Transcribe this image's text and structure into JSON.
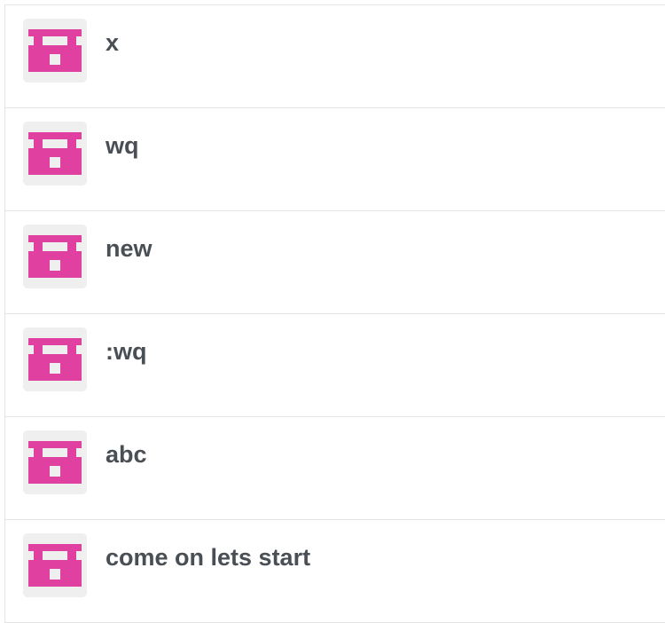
{
  "colors": {
    "avatar_pattern": "#e0409f",
    "avatar_background": "#efefef",
    "title_text": "#494f55",
    "divider": "#e4e4e4"
  },
  "items": [
    {
      "title": "x",
      "avatar_icon": "identicon"
    },
    {
      "title": "wq",
      "avatar_icon": "identicon"
    },
    {
      "title": "new",
      "avatar_icon": "identicon"
    },
    {
      "title": ":wq",
      "avatar_icon": "identicon"
    },
    {
      "title": "abc",
      "avatar_icon": "identicon"
    },
    {
      "title": "come on lets start",
      "avatar_icon": "identicon"
    }
  ]
}
